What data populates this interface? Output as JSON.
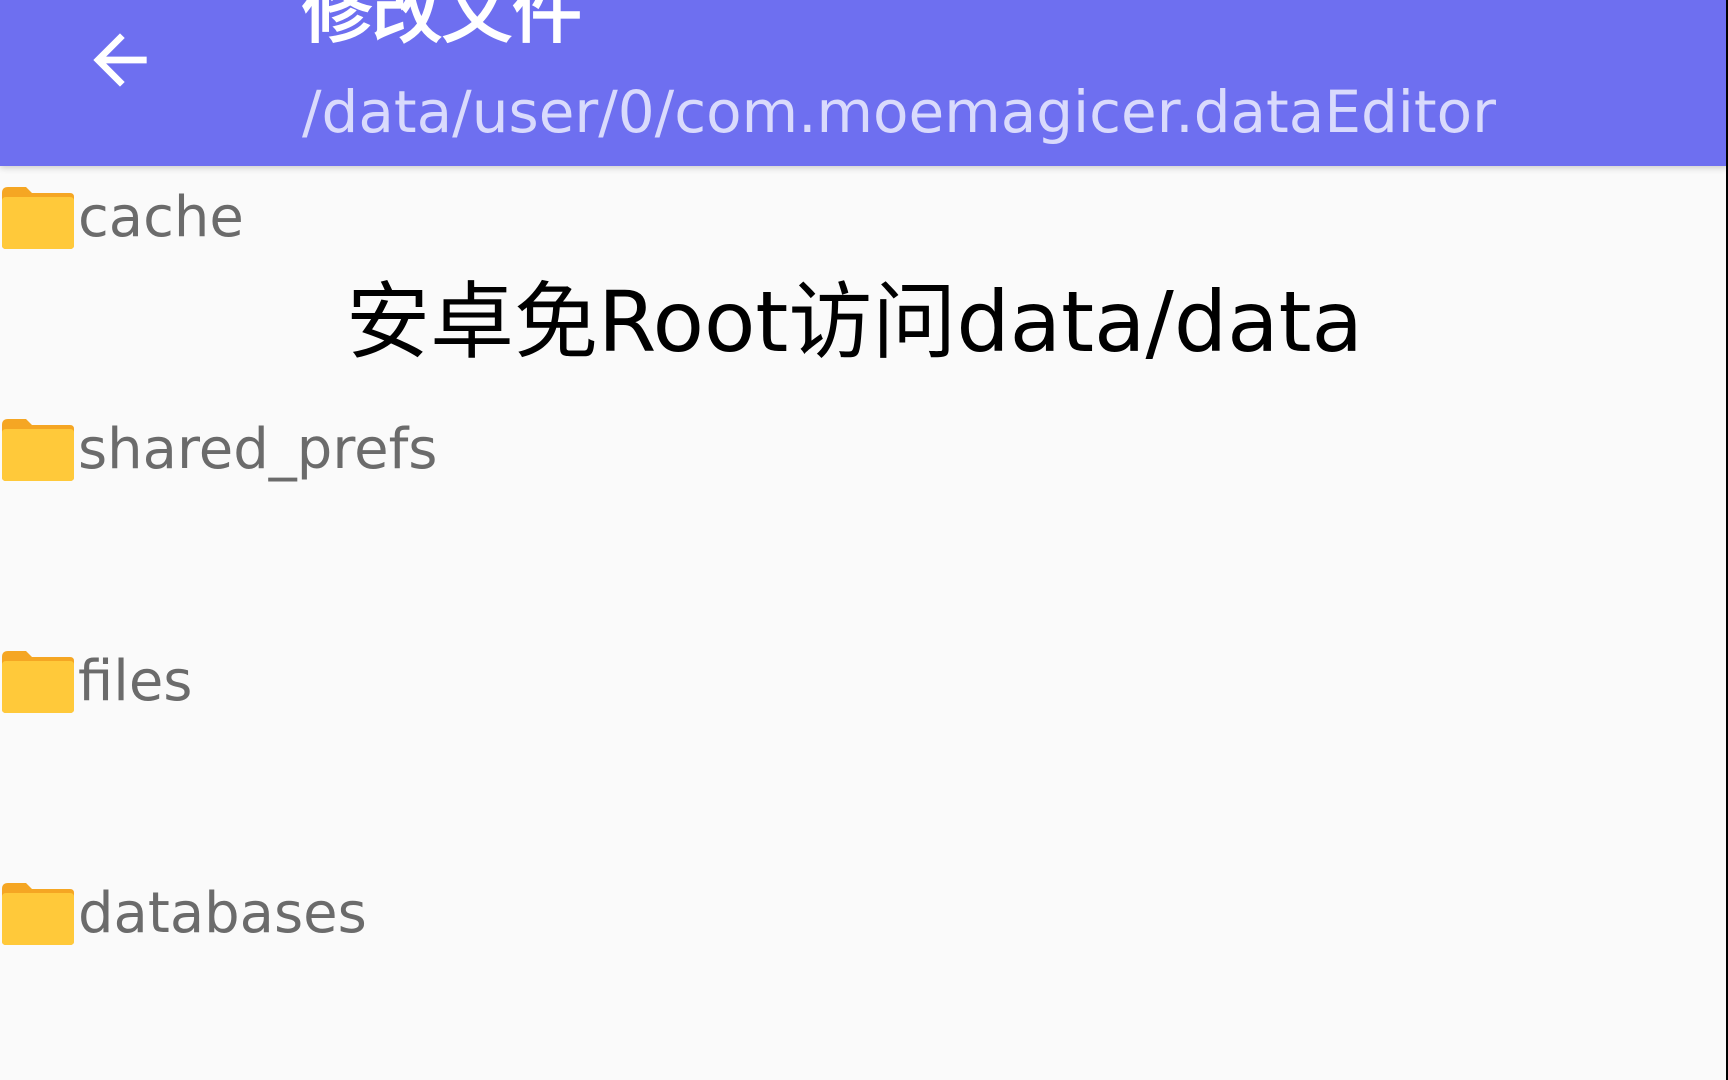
{
  "appbar": {
    "back_icon": "arrow-left-icon",
    "title": "修改文件",
    "subtitle": "/data/user/0/com.moemagicer.dataEditor",
    "color": "#6e6ff0"
  },
  "folders": [
    {
      "name": "cache",
      "icon": "folder-icon"
    },
    {
      "name": "shared_prefs",
      "icon": "folder-icon"
    },
    {
      "name": "files",
      "icon": "folder-icon"
    },
    {
      "name": "databases",
      "icon": "folder-icon"
    }
  ],
  "overlay": {
    "caption": "安卓免Root访问data/data"
  },
  "colors": {
    "folder": "#ffc93a",
    "folder_tab": "#f5a623",
    "background": "#fafafa"
  }
}
